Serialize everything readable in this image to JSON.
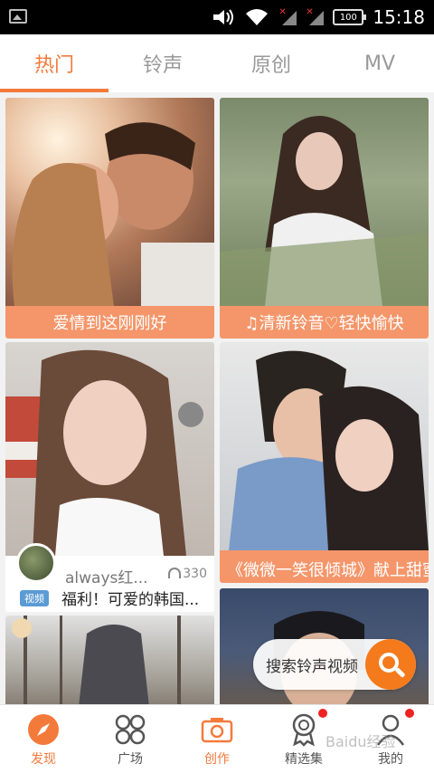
{
  "status_bar": {
    "time": "15:18",
    "battery": "100"
  },
  "tabs": [
    {
      "label": "热门",
      "active": true
    },
    {
      "label": "铃声",
      "active": false
    },
    {
      "label": "原创",
      "active": false
    },
    {
      "label": "MV",
      "active": false
    }
  ],
  "cards": [
    {
      "caption": "爱情到这刚刚好"
    },
    {
      "caption": "♫清新铃音♡轻快愉快"
    },
    {
      "username": "always红...",
      "plays": "330",
      "tag": "视频",
      "description": "福利！可爱的韩国..."
    },
    {
      "caption": "《微微一笑很倾城》献上甜蜜主题曲"
    }
  ],
  "search_fab": {
    "label": "搜索铃声视频"
  },
  "bottom_nav": [
    {
      "label": "发现",
      "active": true
    },
    {
      "label": "广场",
      "active": false
    },
    {
      "label": "创作",
      "active": false
    },
    {
      "label": "精选集",
      "active": false,
      "badge": true
    },
    {
      "label": "我的",
      "active": false,
      "badge": true
    }
  ],
  "watermark": "Baidu经验",
  "colors": {
    "accent": "#f47a3c",
    "caption_bg": "#f4966a",
    "fab_button": "#f47a1c"
  }
}
